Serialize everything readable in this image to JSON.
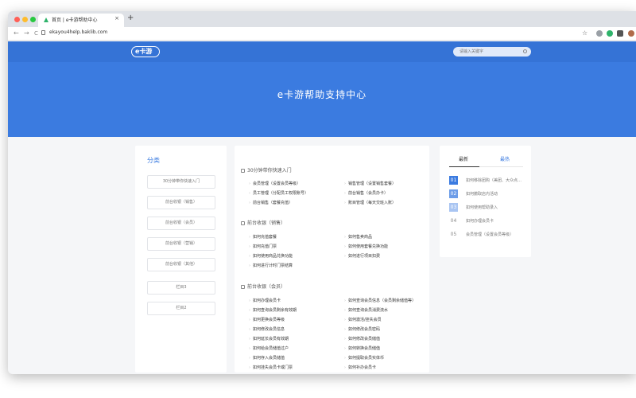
{
  "browser": {
    "tab_title": "首页 | e卡游帮助中心",
    "tab_close": "×",
    "new_tab": "+",
    "url": "ekayou4help.baklib.com",
    "nav": {
      "back": "←",
      "forward": "→",
      "reload": "C"
    },
    "bookmark_star": "☆"
  },
  "header": {
    "logo_text": "e卡游",
    "search_placeholder": "请输入关键字",
    "hero_title": "e卡游帮助支持中心"
  },
  "sidebar": {
    "title": "分类",
    "items": [
      "30分钟带你快速入门",
      "前台收银（销售）",
      "前台收银（会员）",
      "前台收银（营销）",
      "前台收银（其他）",
      "栏目3",
      "栏目2"
    ]
  },
  "main": {
    "sections": [
      {
        "title": "30分钟带你快速入门",
        "left": [
          "会员管理（设置会员等级）",
          "员工管理（分配员工权限账号）",
          "前台销售（套餐充值）"
        ],
        "right": [
          "销售管理（设置销售套餐）",
          "前台销售（会员办卡）",
          "账目管理（每天交班入账）"
        ]
      },
      {
        "title": "前台收银（销售）",
        "left": [
          "如何充值套餐",
          "如何充值门票",
          "如何使用商品兑换功能",
          "如何进行计时门票结算"
        ],
        "right": [
          "如何售卖商品",
          "如何使用套餐兑换功能",
          "如何进行项目扣费"
        ]
      },
      {
        "title": "前台收银（会员）",
        "left": [
          "如何办理会员卡",
          "如何查询会员剩余有效期",
          "如何更换会员等级",
          "如何修改会员信息",
          "如何延长会员有效期",
          "如何给会员储值过户",
          "如何存入会员储值",
          "如何挂失会员卡或门票"
        ],
        "right": [
          "如何查询会员信息（会员剩余储值等）",
          "如何查询会员消费流水",
          "如何激活/挂失会员",
          "如何修改会员密码",
          "如何修改会员储值",
          "如何转换会员储值",
          "如何提取会员实体币",
          "如何补办会员卡"
        ]
      }
    ]
  },
  "right_panel": {
    "tabs": [
      "最新",
      "最热"
    ],
    "items": [
      {
        "num": "01",
        "text": "如何移除团购（美团、大众点评）"
      },
      {
        "num": "02",
        "text": "如何撤取店内活动"
      },
      {
        "num": "03",
        "text": "如何使用帮助录入"
      },
      {
        "num": "04",
        "text": "如何办理会员卡"
      },
      {
        "num": "05",
        "text": "会员管理（设置会员等级）"
      }
    ]
  },
  "colors": {
    "brand_blue": "#3b7be0",
    "rank1": "#3b7be0",
    "rank2": "#6d9de8",
    "rank3": "#a9c5f2"
  }
}
